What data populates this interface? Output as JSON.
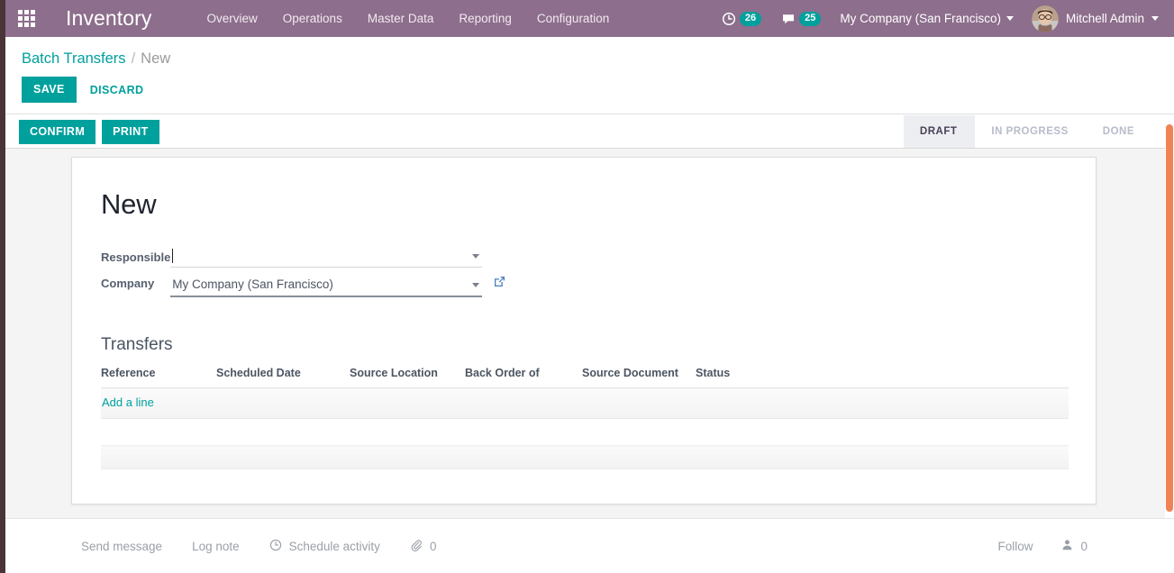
{
  "navbar": {
    "apps_icon": "apps-grid-icon",
    "brand": "Inventory",
    "menu": [
      {
        "label": "Overview"
      },
      {
        "label": "Operations"
      },
      {
        "label": "Master Data"
      },
      {
        "label": "Reporting"
      },
      {
        "label": "Configuration"
      }
    ],
    "systray": {
      "activity_icon": "clock-icon",
      "activity_count": "26",
      "messages_icon": "speech-bubble-icon",
      "messages_count": "25",
      "company": "My Company (San Francisco)",
      "user": "Mitchell Admin",
      "avatar_icon": "user-avatar"
    },
    "colors": {
      "background": "#8d6e8c",
      "badge": "#00a09d"
    }
  },
  "control_panel": {
    "breadcrumb": {
      "parent": "Batch Transfers",
      "separator": "/",
      "current": "New"
    },
    "save_label": "SAVE",
    "discard_label": "DISCARD"
  },
  "action_row": {
    "buttons": [
      {
        "label": "CONFIRM"
      },
      {
        "label": "PRINT"
      }
    ],
    "stages": [
      {
        "label": "DRAFT",
        "active": true
      },
      {
        "label": "IN PROGRESS",
        "active": false
      },
      {
        "label": "DONE",
        "active": false
      }
    ]
  },
  "form": {
    "title": "New",
    "fields": [
      {
        "label": "Responsible",
        "value": "",
        "placeholder": "",
        "dropdown_icon": "chevron-down-icon",
        "focused": true
      },
      {
        "label": "Company",
        "value": "My Company (San Francisco)",
        "placeholder": "",
        "dropdown_icon": "chevron-down-icon",
        "external_icon": "external-link-icon",
        "focused": false
      }
    ],
    "section_title": "Transfers",
    "table": {
      "columns": [
        "Reference",
        "Scheduled Date",
        "Source Location",
        "Back Order of",
        "Source Document",
        "Status"
      ],
      "rows": [],
      "add_line_label": "Add a line"
    }
  },
  "chatter": {
    "send_message": "Send message",
    "log_note": "Log note",
    "schedule_activity": "Schedule activity",
    "schedule_icon": "clock-icon",
    "attachment_icon": "paperclip-icon",
    "attachment_count": "0",
    "follow_label": "Follow",
    "followers_icon": "user-icon",
    "followers_count": "0"
  },
  "scrollbar": {
    "color": "#ef8354"
  }
}
